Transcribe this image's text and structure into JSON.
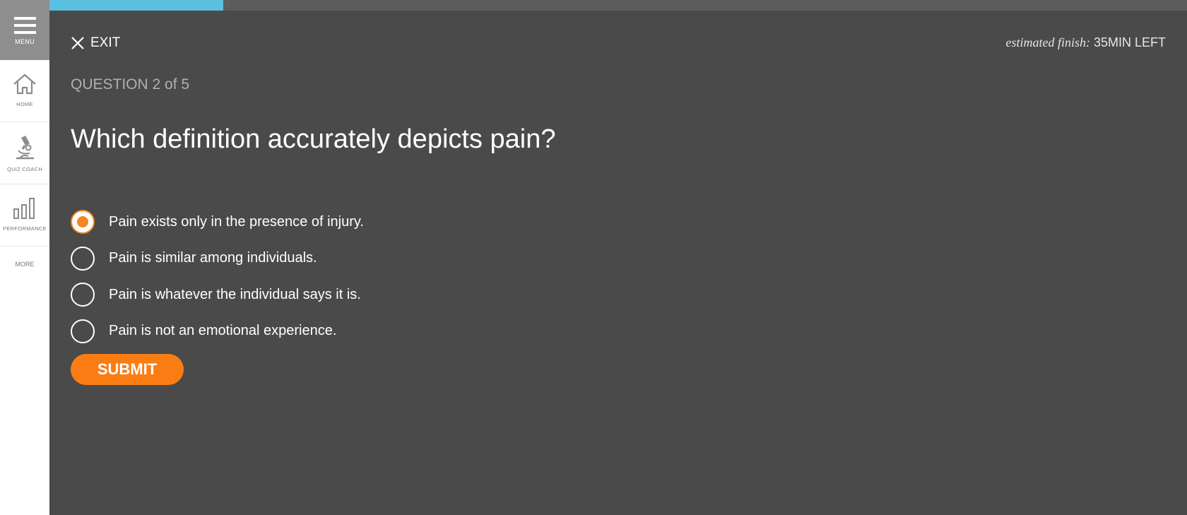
{
  "sidebar": {
    "menu_label": "MENU",
    "items": [
      {
        "label": "HOME",
        "icon": "home-icon"
      },
      {
        "label": "QUIZ COACH",
        "icon": "microscope-icon"
      },
      {
        "label": "PERFORMANCE",
        "icon": "bar-chart-icon"
      }
    ],
    "more_label": "MORE"
  },
  "progress": {
    "fraction": 0.153,
    "fill_color": "#5bbfe0",
    "track_color": "#5c5c5c"
  },
  "header": {
    "exit_label": "EXIT",
    "estimate_label": "estimated finish:",
    "estimate_value": "35MIN LEFT"
  },
  "question": {
    "count_text": "QUESTION 2 of 5",
    "text": "Which definition accurately depicts pain?",
    "options": [
      {
        "label": "Pain exists only in the presence of injury.",
        "selected": true
      },
      {
        "label": "Pain is similar among individuals.",
        "selected": false
      },
      {
        "label": "Pain is whatever the individual says it is.",
        "selected": false
      },
      {
        "label": "Pain is not an emotional experience.",
        "selected": false
      }
    ],
    "submit_label": "SUBMIT"
  },
  "colors": {
    "background": "#4a4a4a",
    "accent": "#fa7d13",
    "menu_bg": "#8e8e8e"
  }
}
